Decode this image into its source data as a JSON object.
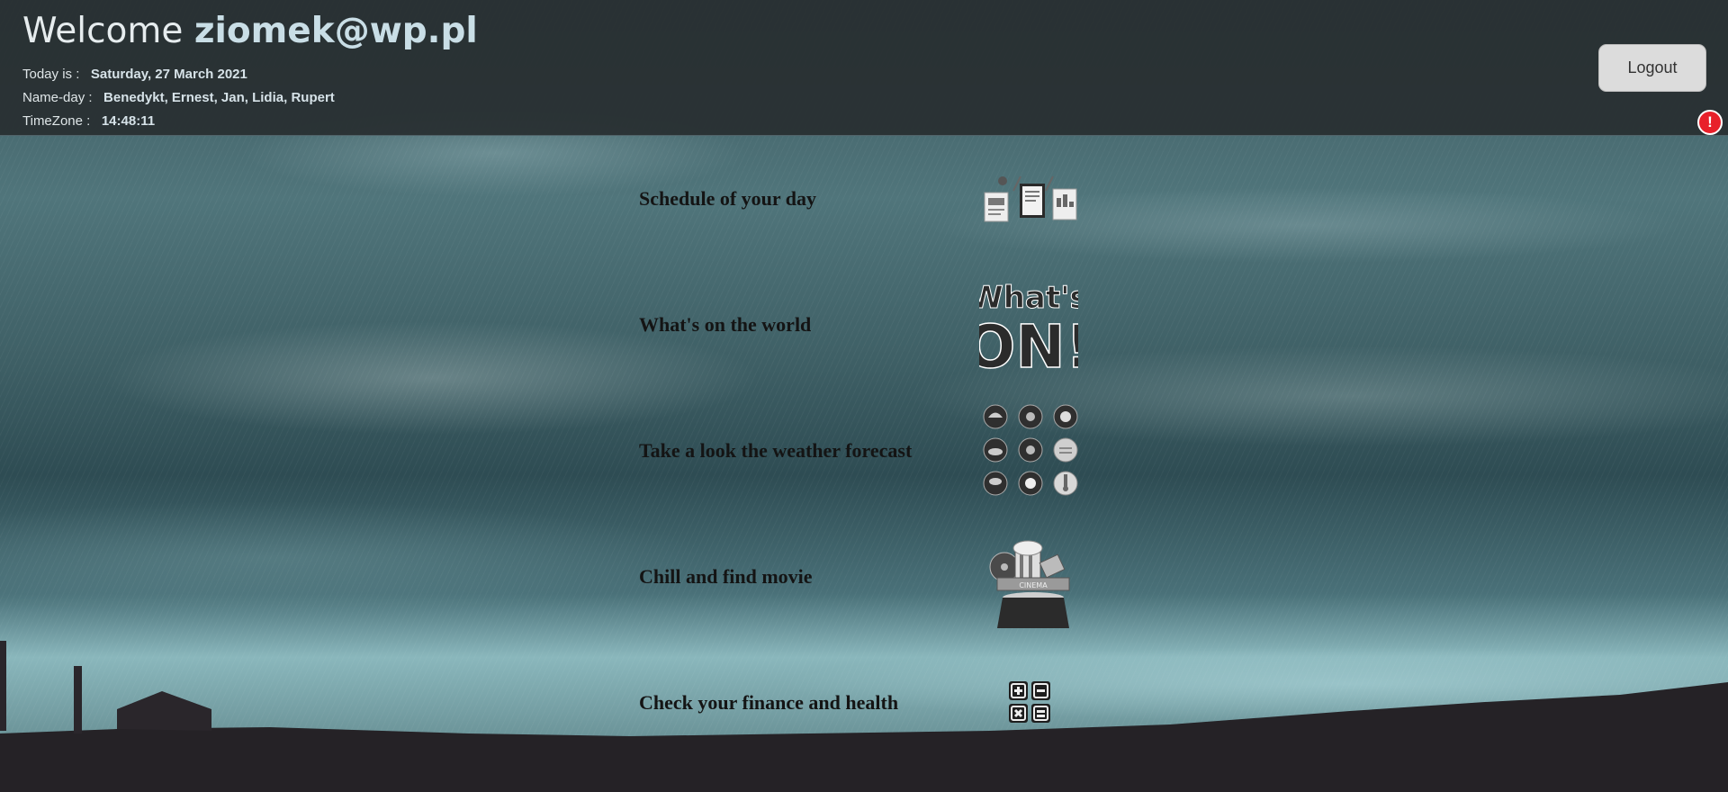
{
  "header": {
    "welcome_prefix": "Welcome",
    "username": "ziomek@wp.pl",
    "today_label": "Today is :",
    "today_value": "Saturday, 27 March 2021",
    "nameday_label": "Name-day :",
    "nameday_value": "Benedykt, Ernest, Jan, Lidia, Rupert",
    "timezone_label": "TimeZone :",
    "timezone_value": "14:48:11",
    "logout_label": "Logout",
    "alert_symbol": "!"
  },
  "menu": {
    "items": [
      {
        "label": "Schedule of your day",
        "icon": "schedule-documents-icon"
      },
      {
        "label": "What's on the world",
        "icon": "whats-on-icon"
      },
      {
        "label": "Take a look the weather forecast",
        "icon": "weather-icons-grid"
      },
      {
        "label": "Chill and find movie",
        "icon": "cinema-popcorn-icon"
      },
      {
        "label": "Check your finance and health",
        "icon": "calculator-icon"
      }
    ],
    "whats_on_text_top": "What's",
    "whats_on_text_bottom": "ON!",
    "cinema_text": "CINEMA"
  },
  "colors": {
    "header_bg": "#282e30",
    "alert": "#e8202a",
    "logout_bg": "#dcdcdc"
  }
}
